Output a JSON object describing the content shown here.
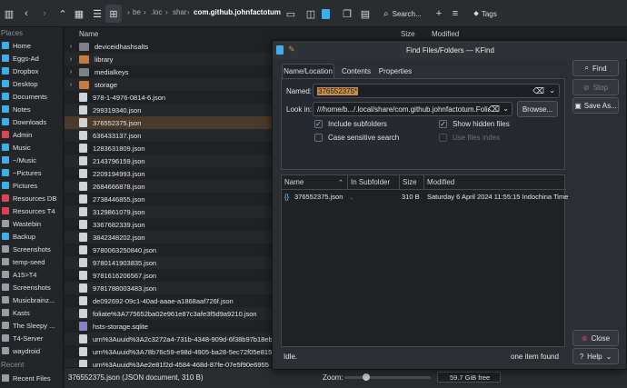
{
  "toolbar": {
    "breadcrumbs": [
      "be",
      ".loc",
      "shar",
      "com.github.johnfactotum"
    ],
    "search_label": "Search...",
    "tags_label": "Tags"
  },
  "sidebar": {
    "places_header": "Places",
    "items": [
      {
        "label": "Home",
        "color": "#3daee9"
      },
      {
        "label": "Eggs-Ad",
        "color": "#3daee9"
      },
      {
        "label": "Dropbox",
        "color": "#3daee9"
      },
      {
        "label": "Desktop",
        "color": "#3daee9"
      },
      {
        "label": "Documents",
        "color": "#3daee9"
      },
      {
        "label": "Notes",
        "color": "#3daee9"
      },
      {
        "label": "Downloads",
        "color": "#3daee9"
      },
      {
        "label": "Admin",
        "color": "#da4453"
      },
      {
        "label": "Music",
        "color": "#3daee9"
      },
      {
        "label": "~/Music",
        "color": "#3daee9"
      },
      {
        "label": "~Pictures",
        "color": "#3daee9"
      },
      {
        "label": "Pictures",
        "color": "#3daee9"
      },
      {
        "label": "Resources DB",
        "color": "#da4453"
      },
      {
        "label": "Resources T4",
        "color": "#da4453"
      },
      {
        "label": "Wastebin",
        "color": "#9a9da3"
      },
      {
        "label": "Backup",
        "color": "#3daee9"
      },
      {
        "label": "Screenshots",
        "color": "#9a9da3"
      },
      {
        "label": "temp-seed",
        "color": "#9a9da3"
      },
      {
        "label": "A15>T4",
        "color": "#9a9da3"
      },
      {
        "label": "Screenshots",
        "color": "#9a9da3"
      },
      {
        "label": "Musicbrainz...",
        "color": "#9a9da3"
      },
      {
        "label": "Kasts",
        "color": "#9a9da3"
      },
      {
        "label": "The Sleepy ...",
        "color": "#9a9da3"
      },
      {
        "label": "T4-Server",
        "color": "#9a9da3"
      },
      {
        "label": "waydroid",
        "color": "#9a9da3"
      }
    ],
    "recent_header": "Recent",
    "recent_items": [
      {
        "label": "Recent Files"
      }
    ]
  },
  "filelist": {
    "col_name": "Name",
    "col_size": "Size",
    "col_modified": "Modified",
    "rows": [
      {
        "name": "deviceidhashsalts",
        "type": "folder",
        "expandable": true
      },
      {
        "name": "library",
        "type": "folder-orange",
        "expandable": true
      },
      {
        "name": "medialkeys",
        "type": "folder",
        "expandable": true
      },
      {
        "name": "storage",
        "type": "folder-orange",
        "expandable": true
      },
      {
        "name": "978-1-4976-0814-6.json",
        "type": "file"
      },
      {
        "name": "299319340.json",
        "type": "file"
      },
      {
        "name": "376552375.json",
        "type": "file",
        "selected": true
      },
      {
        "name": "636433137.json",
        "type": "file"
      },
      {
        "name": "1283631809.json",
        "type": "file"
      },
      {
        "name": "2143796159.json",
        "type": "file"
      },
      {
        "name": "2209194993.json",
        "type": "file"
      },
      {
        "name": "2684666878.json",
        "type": "file"
      },
      {
        "name": "2738446855.json",
        "type": "file"
      },
      {
        "name": "3129861079.json",
        "type": "file"
      },
      {
        "name": "3367682339.json",
        "type": "file"
      },
      {
        "name": "3842348202.json",
        "type": "file"
      },
      {
        "name": "9780063250840.json",
        "type": "file"
      },
      {
        "name": "9780141903835.json",
        "type": "file"
      },
      {
        "name": "9781616206567.json",
        "type": "file"
      },
      {
        "name": "9781788003483.json",
        "type": "file"
      },
      {
        "name": "de092692-09c1-40ad-aaae-a1868aaf726f.json",
        "type": "file"
      },
      {
        "name": "foliate%3A775652ba02e961e87c3afe3f5d9a9210.json",
        "type": "file"
      },
      {
        "name": "hsts-storage.sqlite",
        "type": "db"
      },
      {
        "name": "urn%3Auuid%3A2c3272a4-731b-4348-909d-6f38b97b18eb",
        "type": "file"
      },
      {
        "name": "urn%3Auuid%3A78b76c59-e98d-4905-ba28-5ec72f05e815",
        "type": "file"
      },
      {
        "name": "urn%3Auuid%3Ae2e81f2d-4584-468d-87fe-07e5f90e6955",
        "type": "file"
      }
    ]
  },
  "statusbar": {
    "text": "376552375.json (JSON document, 310 B)",
    "zoom_label": "Zoom:",
    "free_space": "59.7 GiB free"
  },
  "dialog": {
    "title": "Find Files/Folders — KFind",
    "tabs": [
      "Name/Location",
      "Contents",
      "Properties"
    ],
    "name_label": "Named:",
    "name_value": "376552375*",
    "lookin_label": "Look in:",
    "lookin_value": "///home/b.../.local/share/com.github.johnfactotum.Foliate",
    "browse_label": "Browse...",
    "include_subfolders": "Include subfolders",
    "show_hidden": "Show hidden files",
    "case_sensitive": "Case sensitive search",
    "use_files_index": "Use files index",
    "find_label": "Find",
    "stop_label": "Stop",
    "save_as_label": "Save As...",
    "close_label": "Close",
    "help_label": "Help",
    "results_cols": [
      "Name",
      "In Subfolder",
      "Size",
      "Modified"
    ],
    "results": [
      {
        "name": "376552375.json",
        "subfolder": ".",
        "size": "310 B",
        "modified": "Saturday 6 April 2024 11:55:15 Indochina Time"
      }
    ],
    "status_left": "Idle.",
    "status_right": "one item found"
  },
  "colors": {
    "accent": "#3daee9",
    "selection_row": "#4a3a2a",
    "admin_red": "#da4453"
  }
}
